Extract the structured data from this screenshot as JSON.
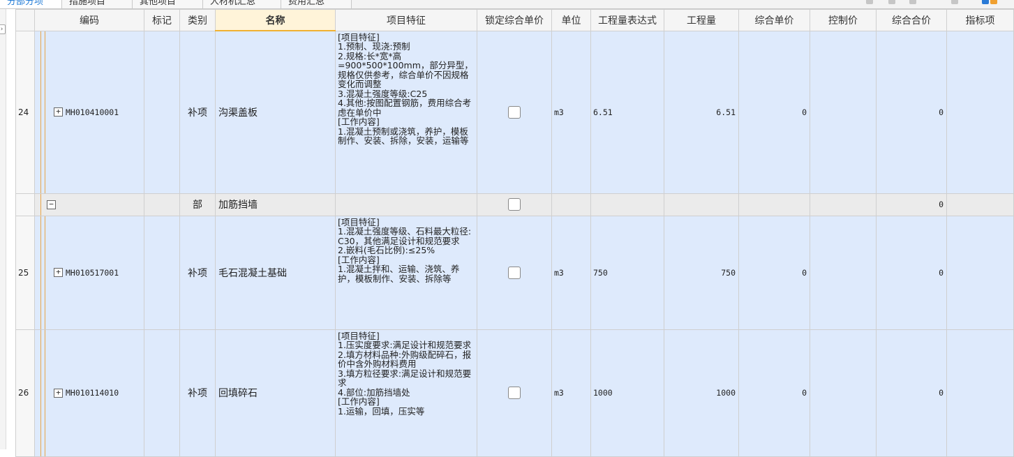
{
  "tabs": [
    {
      "label": "分部分项",
      "active": true
    },
    {
      "label": "措施项目",
      "active": false
    },
    {
      "label": "其他项目",
      "active": false
    },
    {
      "label": "人材机汇总",
      "active": false
    },
    {
      "label": "费用汇总",
      "active": false
    }
  ],
  "columns": {
    "code": "编码",
    "mark": "标记",
    "type": "类别",
    "name": "名称",
    "features": "项目特征",
    "lock": "锁定综合单价",
    "unit": "单位",
    "expr": "工程量表达式",
    "qty": "工程量",
    "unit_price": "综合单价",
    "control": "控制价",
    "total": "综合合价",
    "index": "指标项"
  },
  "rows": [
    {
      "kind": "item",
      "no": "24",
      "expand": "+",
      "code": "MH010410001",
      "type": "补项",
      "name": "沟渠盖板",
      "features": "[项目特征]\n1.预制、现浇:预制\n2.规格:长*宽*高\n=900*500*100mm，部分异型，规格仅供参考，综合单价不因规格变化而调整\n3.混凝土强度等级:C25\n4.其他:按图配置钢筋，费用综合考虑在单价中\n[工作内容]\n1.混凝土预制或浇筑，养护，模板制作、安装、拆除，安装，运输等",
      "unit": "m3",
      "expr": "6.51",
      "qty": "6.51",
      "unit_price": "0",
      "control": "",
      "total": "0",
      "index": ""
    },
    {
      "kind": "part",
      "no": "",
      "expand": "−",
      "code": "",
      "type": "部",
      "name": "加筋挡墙",
      "features": "",
      "unit": "",
      "expr": "",
      "qty": "",
      "unit_price": "",
      "control": "",
      "total": "0",
      "index": ""
    },
    {
      "kind": "item",
      "no": "25",
      "expand": "+",
      "code": "MH010517001",
      "type": "补项",
      "name": "毛石混凝土基础",
      "features": "[项目特征]\n1.混凝土强度等级、石料最大粒径:C30，其他满足设计和规范要求\n2.嵌料(毛石比例):≤25%\n[工作内容]\n1.混凝土拌和、运输、浇筑、养护，模板制作、安装、拆除等",
      "unit": "m3",
      "expr": "750",
      "qty": "750",
      "unit_price": "0",
      "control": "",
      "total": "0",
      "index": ""
    },
    {
      "kind": "item",
      "no": "26",
      "expand": "+",
      "code": "MH010114010",
      "type": "补项",
      "name": "回填碎石",
      "features": "[项目特征]\n1.压实度要求:满足设计和规范要求\n2.填方材料品种:外购级配碎石，报价中含外购材料费用\n3.填方粒径要求:满足设计和规范要求\n4.部位:加筋挡墙处\n[工作内容]\n1.运输，回填，压实等",
      "unit": "m3",
      "expr": "1000",
      "qty": "1000",
      "unit_price": "0",
      "control": "",
      "total": "0",
      "index": ""
    }
  ]
}
